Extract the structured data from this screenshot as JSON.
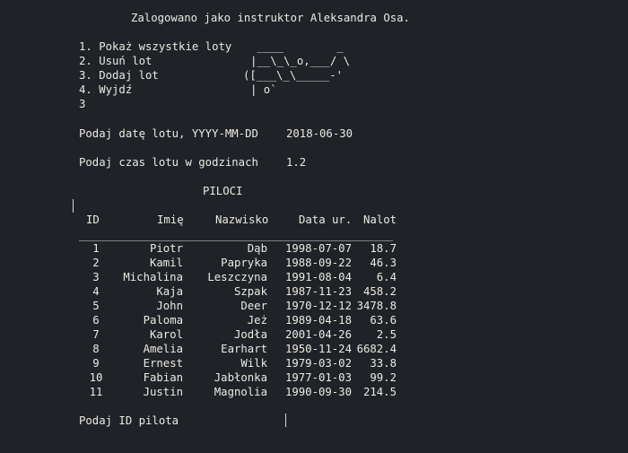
{
  "header": {
    "login_text": "Zalogowano jako instruktor Aleksandra Osa."
  },
  "menu": {
    "items": [
      "1. Pokaż wszystkie loty",
      "2. Usuń lot",
      "3. Dodaj lot",
      "4. Wyjdź"
    ],
    "choice": "3"
  },
  "ascii_plane": [
    " ____        _",
    "|__\\_\\_o,___/ \\",
    "([___\\_\\_____-'",
    "| o`"
  ],
  "prompts": {
    "date_label": "Podaj datę lotu, YYYY-MM-DD",
    "date_value": "2018-06-30",
    "time_label": "Podaj czas lotu w godzinach",
    "time_value": "1.2",
    "pilot_id_label": "Podaj ID pilota"
  },
  "table": {
    "title": "PILOCI",
    "headers": [
      "ID",
      "Imię",
      "Nazwisko",
      "Data ur.",
      "Nalot"
    ],
    "rule": "______________________________________________________",
    "rows": [
      [
        "1",
        "Piotr",
        "Dąb",
        "1998-07-07",
        "18.7"
      ],
      [
        "2",
        "Kamil",
        "Papryka",
        "1988-09-22",
        "46.3"
      ],
      [
        "3",
        "Michalina",
        "Leszczyna",
        "1991-08-04",
        "6.4"
      ],
      [
        "4",
        "Kaja",
        "Szpak",
        "1987-11-23",
        "458.2"
      ],
      [
        "5",
        "John",
        "Deer",
        "1970-12-12",
        "3478.8"
      ],
      [
        "6",
        "Paloma",
        "Jeż",
        "1989-04-18",
        "63.6"
      ],
      [
        "7",
        "Karol",
        "Jodła",
        "2001-04-26",
        "2.5"
      ],
      [
        "8",
        "Amelia",
        "Earhart",
        "1950-11-24",
        "6682.4"
      ],
      [
        "9",
        "Ernest",
        "Wilk",
        "1979-03-02",
        "33.8"
      ],
      [
        "10",
        "Fabian",
        "Jabłonka",
        "1977-01-03",
        "99.2"
      ],
      [
        "11",
        "Justin",
        "Magnolia",
        "1990-09-30",
        "214.5"
      ]
    ]
  }
}
